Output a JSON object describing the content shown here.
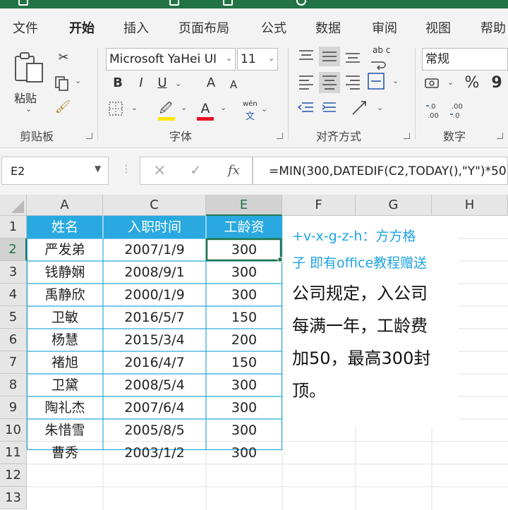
{
  "ribbon_tabs": [
    "文件",
    "开始",
    "插入",
    "页面布局",
    "公式",
    "数据",
    "审阅",
    "视图",
    "帮助"
  ],
  "clipboard": {
    "paste_label": "粘贴",
    "group_label": "剪贴板"
  },
  "font": {
    "name": "Microsoft YaHei UI",
    "size": "11",
    "bold": "B",
    "italic": "I",
    "underline": "U",
    "grow": "A",
    "shrink": "A",
    "phonetic": "wén",
    "phonetic_char": "文",
    "group_label": "字体",
    "fill_color": "#ffe600",
    "font_color": "#e81123"
  },
  "alignment": {
    "group_label": "对齐方式",
    "wrap_label": "ab c"
  },
  "number": {
    "format": "常规",
    "group_label": "数字",
    "percent": "%",
    "comma": "9"
  },
  "formula_bar": {
    "name_box": "E2",
    "cancel": "×",
    "enter": "✓",
    "fx": "fx",
    "formula": "=MIN(300,DATEDIF(C2,TODAY(),\"Y\")*50)"
  },
  "columns": [
    "A",
    "C",
    "E",
    "F",
    "G",
    "H"
  ],
  "rows": [
    "1",
    "2",
    "3",
    "4",
    "5",
    "6",
    "7",
    "8",
    "9",
    "10",
    "11",
    "12",
    "13"
  ],
  "table": {
    "headers": [
      "姓名",
      "入职时间",
      "工龄资"
    ],
    "rows": [
      [
        "严发弟",
        "2007/1/9",
        "300"
      ],
      [
        "钱静娴",
        "2008/9/1",
        "300"
      ],
      [
        "禹静欣",
        "2000/1/9",
        "300"
      ],
      [
        "卫敏",
        "2016/5/7",
        "150"
      ],
      [
        "杨慧",
        "2015/3/4",
        "200"
      ],
      [
        "褚旭",
        "2016/4/7",
        "150"
      ],
      [
        "卫黛",
        "2008/5/4",
        "300"
      ],
      [
        "陶礼杰",
        "2007/6/4",
        "300"
      ],
      [
        "朱惜雪",
        "2005/8/5",
        "300"
      ],
      [
        "曹秀",
        "2003/1/2",
        "300"
      ]
    ]
  },
  "notes": {
    "line1": "+v-x-g-z-h：方方格",
    "line2": "子 即有office教程赠送",
    "body": [
      "公司规定，入公司",
      "每满一年，工龄费",
      "加50，最高300封",
      "顶。"
    ]
  },
  "colors": {
    "accent": "#217346",
    "header_fill": "#29a9e0",
    "note_blue": "#1fa3e0"
  }
}
